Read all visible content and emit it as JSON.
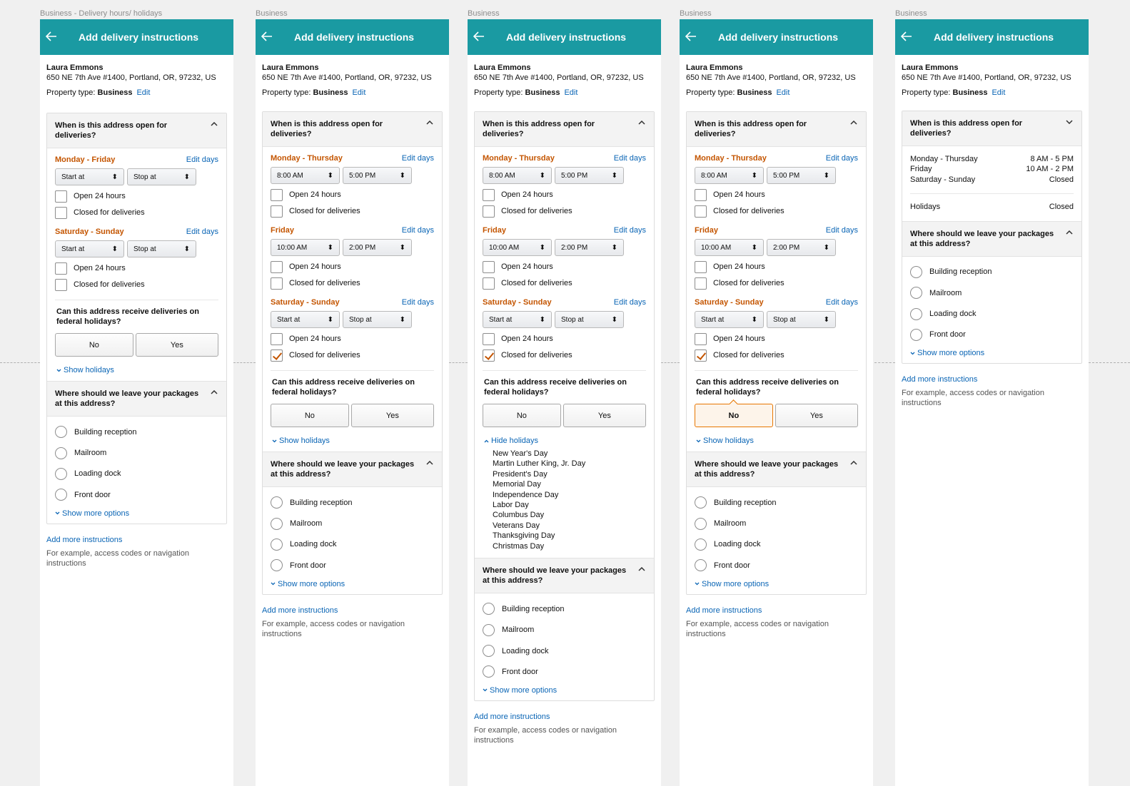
{
  "labels": [
    "Business - Delivery hours/ holidays",
    "Business",
    "Business",
    "Business",
    "Business"
  ],
  "common": {
    "title": "Add delivery instructions",
    "name": "Laura Emmons",
    "address": "650 NE 7th Ave #1400, Portland, OR, 97232, US",
    "property_prefix": "Property type: ",
    "property_value": "Business",
    "edit": "Edit",
    "hours_q": "When is this address open for deliveries?",
    "edit_days": "Edit days",
    "start_at": "Start at",
    "stop_at": "Stop at",
    "open24": "Open 24 hours",
    "closed": "Closed for deliveries",
    "holiday_q": "Can this address receive deliveries on federal holidays?",
    "no": "No",
    "yes": "Yes",
    "show_holidays": "Show holidays",
    "hide_holidays": "Hide holidays",
    "packages_q": "Where should we leave your packages at this address?",
    "locations": [
      "Building reception",
      "Mailroom",
      "Loading dock",
      "Front door"
    ],
    "show_more": "Show more options",
    "add_more": "Add more instructions",
    "example": "For example, access codes or navigation instructions"
  },
  "frame1_days": [
    "Monday - Friday",
    "Saturday - Sunday"
  ],
  "frame2to4_days": [
    "Monday - Thursday",
    "Friday",
    "Saturday - Sunday"
  ],
  "times": {
    "mt_start": "8:00 AM",
    "mt_stop": "5:00 PM",
    "fri_start": "10:00 AM",
    "fri_stop": "2:00 PM"
  },
  "holidays": [
    "New Year's Day",
    "Martin Luther King, Jr. Day",
    "President's Day",
    "Memorial Day",
    "Independence Day",
    "Labor Day",
    "Columbus Day",
    "Veterans Day",
    "Thanksgiving Day",
    "Christmas Day"
  ],
  "summary": {
    "rows": [
      {
        "days": "Monday - Thursday",
        "hours": "8 AM - 5 PM"
      },
      {
        "days": "Friday",
        "hours": "10 AM - 2 PM"
      },
      {
        "days": "Saturday - Sunday",
        "hours": "Closed"
      }
    ],
    "holidays_label": "Holidays",
    "holidays_value": "Closed"
  },
  "colors": {
    "header": "#1a9aa2",
    "day_label": "#c45500",
    "link": "#0a65b5",
    "selected": "#e77600"
  }
}
